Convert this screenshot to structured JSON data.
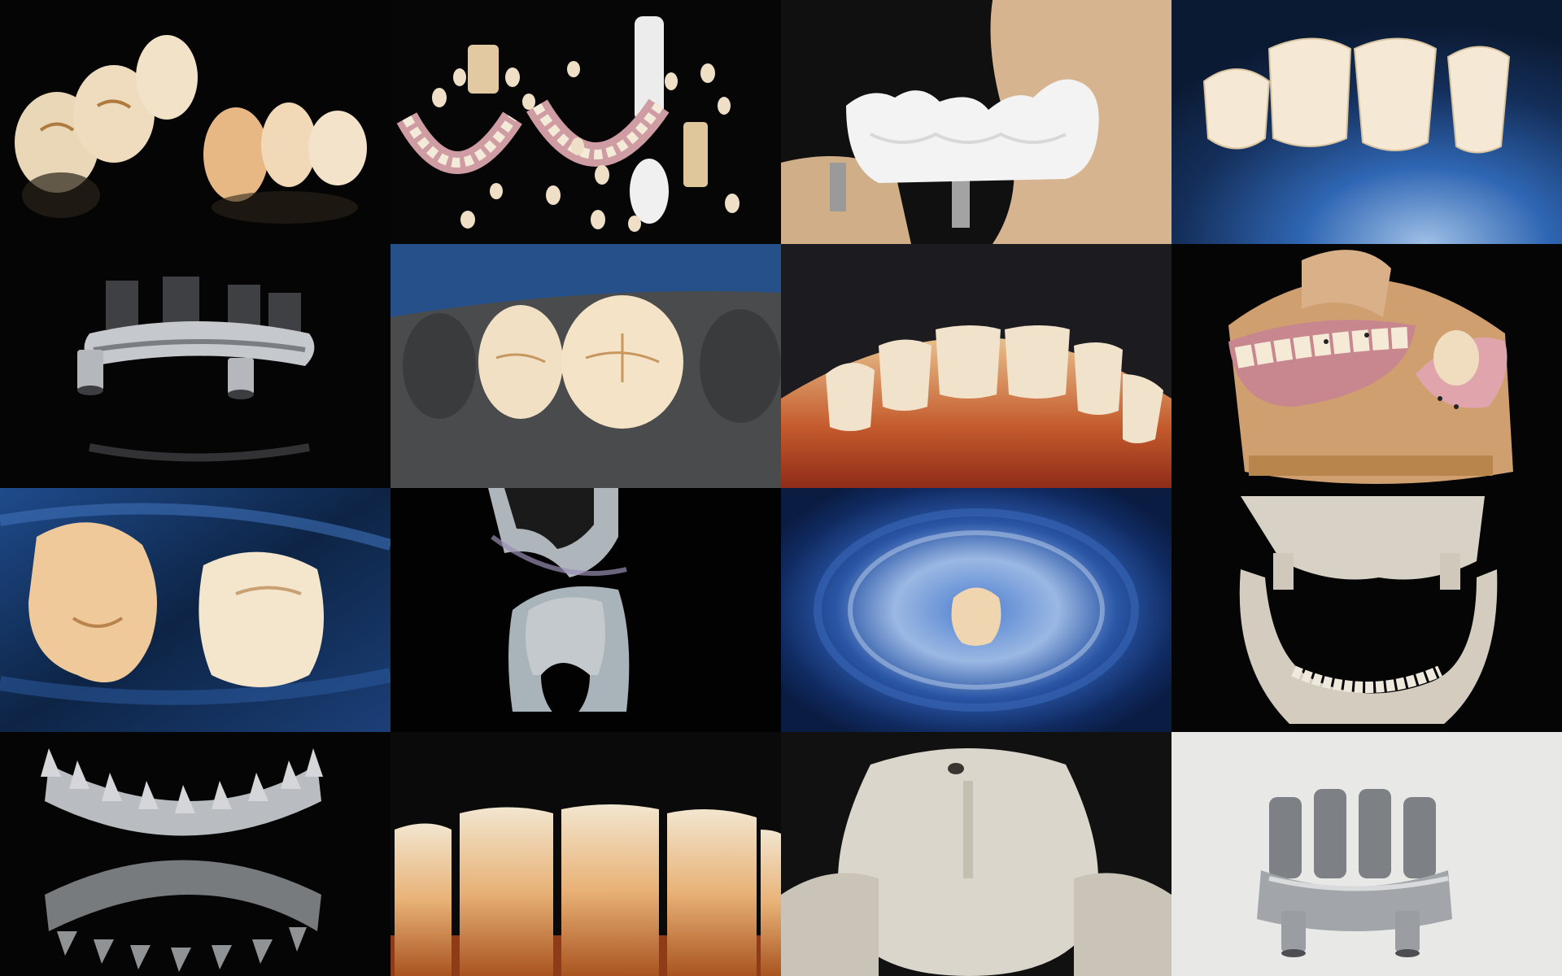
{
  "layout": {
    "rows": 4,
    "columns": 4
  },
  "tiles": [
    {
      "subject": "ceramic-posterior-bridges",
      "background": "#050505"
    },
    {
      "subject": "denture-teeth-and-blocks",
      "background": "#060606"
    },
    {
      "subject": "zirconia-bridge-on-model",
      "background": "#101010"
    },
    {
      "subject": "four-veneers-on-agate",
      "background": "#16324f"
    },
    {
      "subject": "metal-implant-bar",
      "background": "#050505"
    },
    {
      "subject": "two-crowns-on-gray-model",
      "background": "#1d3b66"
    },
    {
      "subject": "anterior-teeth-translucency",
      "background": "#1b1b20"
    },
    {
      "subject": "denture-on-articulator",
      "background": "#050505"
    },
    {
      "subject": "two-molar-crowns-on-agate",
      "background": "#0f2748"
    },
    {
      "subject": "tooth-cross-section",
      "background": "#020202"
    },
    {
      "subject": "crown-on-agate-slice",
      "background": "#102a60"
    },
    {
      "subject": "skull-model",
      "background": "#050505"
    },
    {
      "subject": "metal-framework-reflection",
      "background": "#050505"
    },
    {
      "subject": "anterior-teeth-closeup",
      "background": "#0a0a0a"
    },
    {
      "subject": "maxilla-model",
      "background": "#111111"
    },
    {
      "subject": "metal-framework-white-bg",
      "background": "#e8e8e6"
    }
  ],
  "palette": {
    "enamel": "#f3e6cf",
    "enamel_warm": "#e9c18f",
    "gingiva": "#c98c96",
    "metal": "#b9bcc0",
    "metal_dark": "#5a5d61",
    "plaster": "#d8b992",
    "agate_blue": "#2b63b7",
    "gray_model": "#4a4b4d",
    "zirconia": "#f4f4f4"
  }
}
